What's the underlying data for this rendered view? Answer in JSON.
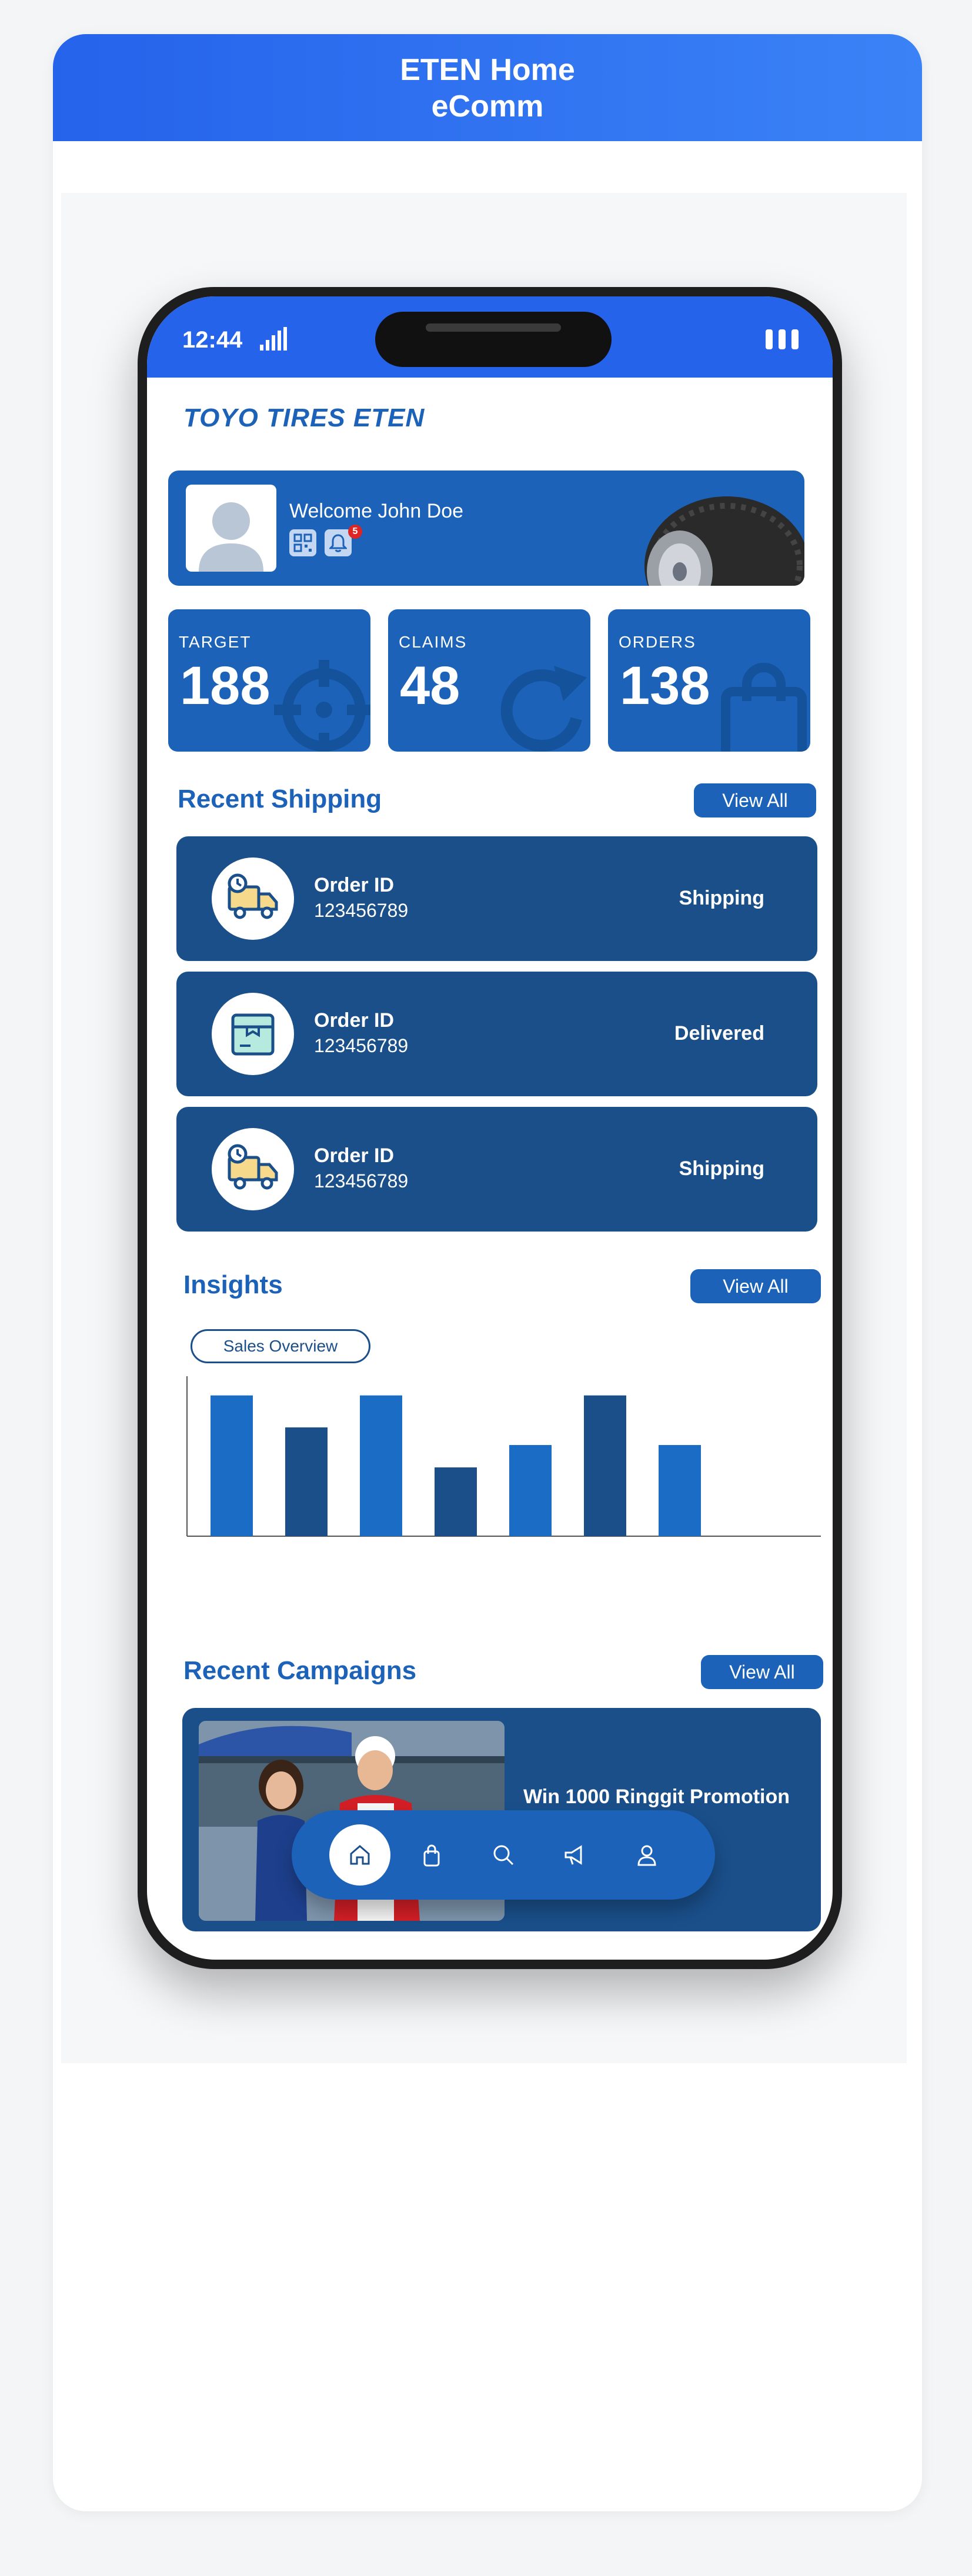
{
  "header": {
    "line1": "ETEN Home",
    "line2": "eComm"
  },
  "status_bar": {
    "time": "12:44"
  },
  "brand": {
    "logo_text": "TOYO TIRES ETEN"
  },
  "welcome": {
    "text": "Welcome John Doe",
    "notification_count": "5"
  },
  "stats": [
    {
      "label": "TARGET",
      "value": "188",
      "icon": "target-icon"
    },
    {
      "label": "CLAIMS",
      "value": "48",
      "icon": "refresh-icon"
    },
    {
      "label": "ORDERS",
      "value": "138",
      "icon": "shopping-bag-icon"
    }
  ],
  "recent_shipping": {
    "title": "Recent Shipping",
    "view_all": "View All",
    "items": [
      {
        "label": "Order ID",
        "id": "123456789",
        "status": "Shipping",
        "icon": "delivery-truck-icon"
      },
      {
        "label": "Order ID",
        "id": "123456789",
        "status": "Delivered",
        "icon": "package-box-icon"
      },
      {
        "label": "Order ID",
        "id": "123456789",
        "status": "Shipping",
        "icon": "delivery-truck-icon"
      }
    ]
  },
  "insights": {
    "title": "Insights",
    "view_all": "View All",
    "filter_label": "Sales Overview"
  },
  "chart_data": {
    "type": "bar",
    "categories": [
      "",
      "",
      "",
      "",
      "",
      "",
      ""
    ],
    "values": [
      88,
      68,
      88,
      43,
      57,
      88,
      57
    ],
    "ylim": [
      0,
      100
    ],
    "colors": [
      "#1b6cc4",
      "#1a4f8a",
      "#1b6cc4",
      "#1a4f8a",
      "#1b6cc4",
      "#1a4f8a",
      "#1b6cc4"
    ],
    "grid": false
  },
  "recent_campaigns": {
    "title": "Recent Campaigns",
    "view_all": "View All",
    "items": [
      {
        "title": "Win 1000 Ringgit Promotion"
      }
    ]
  },
  "bottom_nav": [
    "home-icon",
    "shopping-bag-icon",
    "search-icon",
    "megaphone-icon",
    "user-icon"
  ],
  "colors": {
    "primary": "#1b62b8",
    "dark": "#1a4f8a",
    "header": "#2563eb"
  }
}
